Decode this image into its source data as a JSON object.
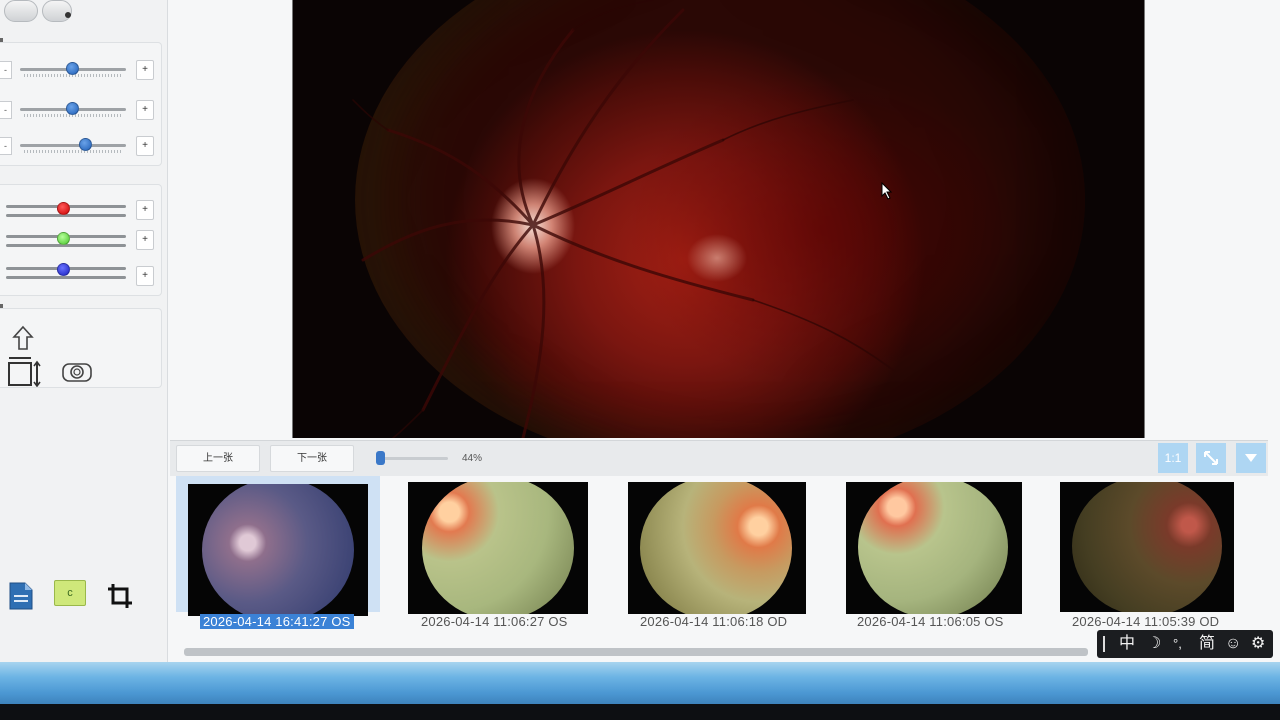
{
  "left_panel": {
    "brightness_sliders": [
      {
        "label": "-",
        "plus": "+",
        "value": 0.5
      },
      {
        "label": "-",
        "plus": "+",
        "value": 0.5
      },
      {
        "label": "-",
        "plus": "+",
        "value": 0.62
      }
    ],
    "rgb_sliders": [
      {
        "channel": "red",
        "color": "#d81818",
        "plus": "+",
        "value": 0.5
      },
      {
        "channel": "green",
        "color": "#66e04a",
        "plus": "+",
        "value": 0.5
      },
      {
        "channel": "blue",
        "color": "#2a35d8",
        "plus": "+",
        "value": 0.5
      }
    ],
    "tools": [
      "up-arrow-icon",
      "crop-frame-icon",
      "camera-icon",
      "document-icon",
      "color-c-icon",
      "crop-icon"
    ]
  },
  "nav": {
    "prev_label": "上一张",
    "next_label": "下一张",
    "zoom_percent": "44%",
    "ratio_label": "1:1"
  },
  "thumbnails": [
    {
      "label": "2026-04-14 16:41:27 OS",
      "selected": true
    },
    {
      "label": "2026-04-14 11:06:27 OS",
      "selected": false
    },
    {
      "label": "2026-04-14 11:06:18 OD",
      "selected": false
    },
    {
      "label": "2026-04-14 11:06:05 OS",
      "selected": false
    },
    {
      "label": "2026-04-14 11:05:39 OD",
      "selected": false
    }
  ],
  "ime": {
    "mode": "中",
    "moon": "☽",
    "punct": "°,",
    "simplified": "简",
    "emoji": "☺",
    "settings": "⚙"
  }
}
